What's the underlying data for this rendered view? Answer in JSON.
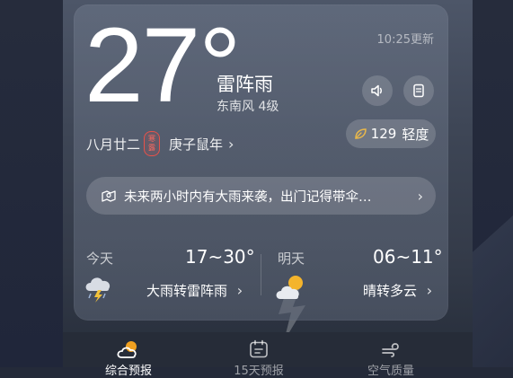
{
  "header": {
    "temperature": "27°",
    "update_time": "10:25更新",
    "condition": "雷阵雨",
    "wind": "东南风 4级"
  },
  "calendar": {
    "lunar_date": "八月廿二",
    "solar_term": [
      "寒",
      "露"
    ],
    "ganzhi_year": "庚子鼠年"
  },
  "air_quality": {
    "value": "129",
    "level": "轻度"
  },
  "alert": {
    "text": "未来两小时内有大雨来袭，出门记得带伞…"
  },
  "forecast": {
    "today": {
      "label": "今天",
      "temp_range": "17~30°",
      "desc": "大雨转雷阵雨",
      "icon": "thunderstorm-icon"
    },
    "tomorrow": {
      "label": "明天",
      "temp_range": "06~11°",
      "desc": "晴转多云",
      "icon": "partly-cloudy-icon"
    }
  },
  "nav": {
    "items": [
      {
        "label": "综合预报",
        "icon": "sun-cloud-icon",
        "active": true
      },
      {
        "label": "15天预报",
        "icon": "calendar-icon",
        "active": false
      },
      {
        "label": "空气质量",
        "icon": "wind-icon",
        "active": false
      }
    ]
  },
  "colors": {
    "background": "#242a39",
    "card": "#5c6576",
    "accent_orange": "#f0a020",
    "solar_term_red": "#e8524a",
    "aqi_leaf": "#e9b84a"
  }
}
